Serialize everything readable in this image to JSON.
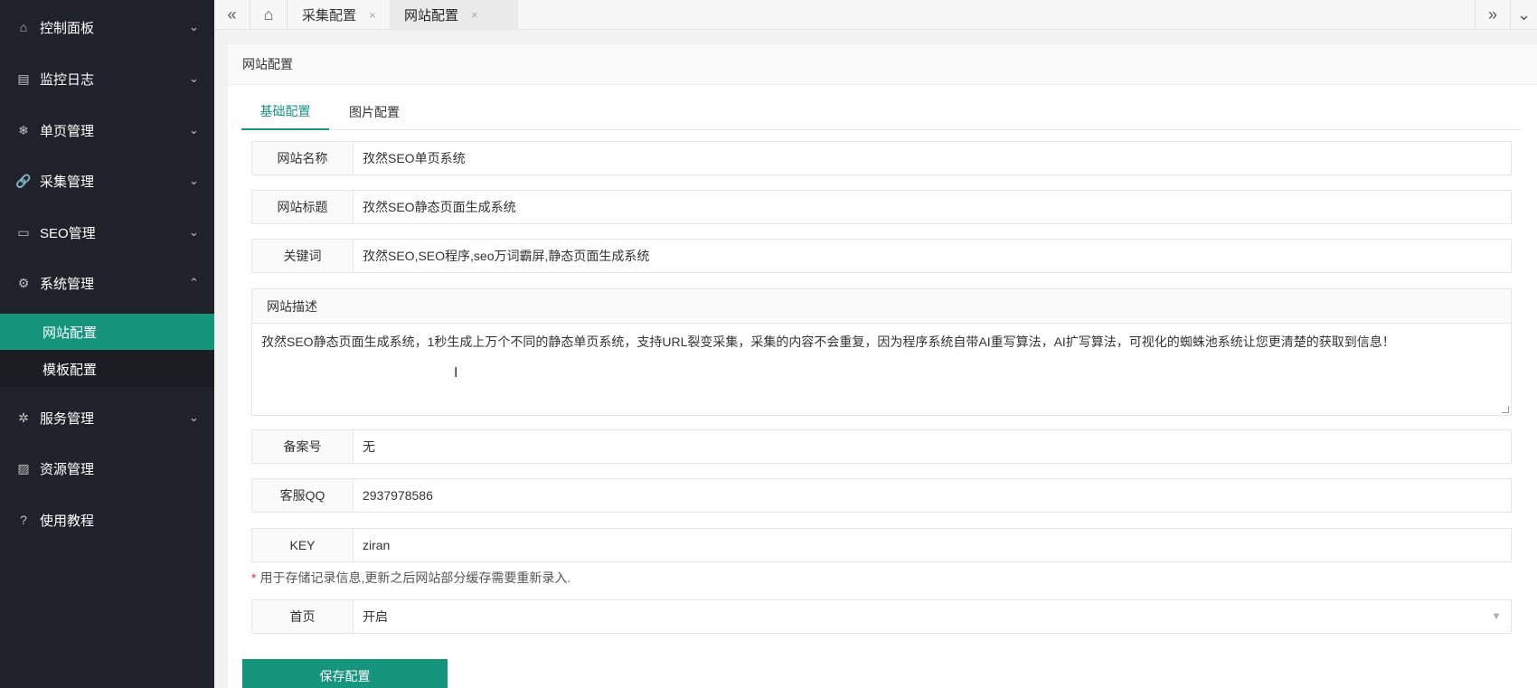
{
  "sidebar": {
    "items": [
      {
        "label": "控制面板",
        "icon": "home-icon",
        "glyph": "⌂",
        "arrow": "⌄"
      },
      {
        "label": "监控日志",
        "icon": "log-icon",
        "glyph": "▤",
        "arrow": "⌄"
      },
      {
        "label": "单页管理",
        "icon": "snowflake-icon",
        "glyph": "❄",
        "arrow": "⌄"
      },
      {
        "label": "采集管理",
        "icon": "link-icon",
        "glyph": "🔗",
        "arrow": "⌄"
      },
      {
        "label": "SEO管理",
        "icon": "monitor-icon",
        "glyph": "▭",
        "arrow": "⌄"
      },
      {
        "label": "系统管理",
        "icon": "gear-icon",
        "glyph": "⚙",
        "arrow": "⌃"
      },
      {
        "label": "服务管理",
        "icon": "service-icon",
        "glyph": "✲",
        "arrow": "⌄"
      },
      {
        "label": "资源管理",
        "icon": "image-icon",
        "glyph": "▨",
        "arrow": ""
      },
      {
        "label": "使用教程",
        "icon": "help-icon",
        "glyph": "?",
        "arrow": ""
      }
    ],
    "sub": [
      {
        "label": "网站配置",
        "active": true
      },
      {
        "label": "模板配置",
        "active": false
      }
    ]
  },
  "tabbar": {
    "prev": "«",
    "home": "⌂",
    "next": "»",
    "more": "⌄",
    "tabs": [
      {
        "label": "采集配置",
        "close": "×"
      },
      {
        "label": "网站配置",
        "close": "×"
      }
    ]
  },
  "card": {
    "title": "网站配置",
    "tabs": [
      "基础配置",
      "图片配置"
    ]
  },
  "form": {
    "site_name": {
      "label": "网站名称",
      "value": "孜然SEO单页系统"
    },
    "site_title": {
      "label": "网站标题",
      "value": "孜然SEO静态页面生成系统"
    },
    "keywords": {
      "label": "关键词",
      "value": "孜然SEO,SEO程序,seo万词霸屏,静态页面生成系统"
    },
    "description": {
      "label": "网站描述",
      "value": "孜然SEO静态页面生成系统，1秒生成上万个不同的静态单页系统，支持URL裂变采集，采集的内容不会重复，因为程序系统自带AI重写算法，AI扩写算法，可视化的蜘蛛池系统让您更清楚的获取到信息！"
    },
    "icp": {
      "label": "备案号",
      "value": "无"
    },
    "qq": {
      "label": "客服QQ",
      "value": "2937978586"
    },
    "key": {
      "label": "KEY",
      "value": "ziran"
    },
    "key_note": {
      "star": "*",
      "text": "用于存储记录信息,更新之后网站部分缓存需要重新录入."
    },
    "homepage": {
      "label": "首页",
      "value": "开启"
    }
  },
  "save_label": "保存配置",
  "colors": {
    "accent": "#16957d",
    "sidebar_bg": "#20222a"
  }
}
